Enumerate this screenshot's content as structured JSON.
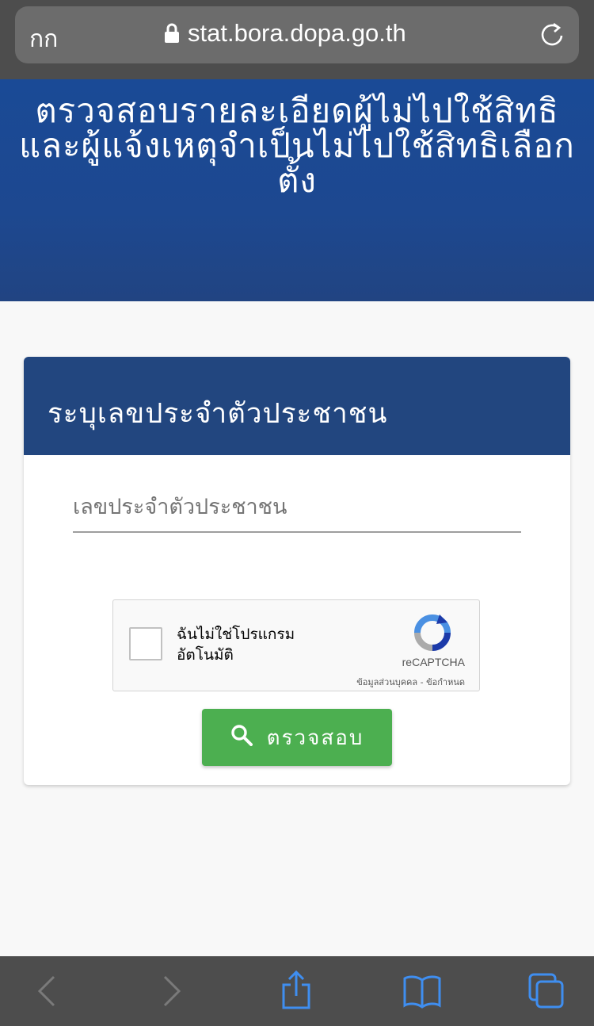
{
  "browser": {
    "text_size_label": "กก",
    "url": "stat.bora.dopa.go.th"
  },
  "header": {
    "title": "ตรวจสอบรายละเอียดผู้ไม่ไปใช้สิทธิและผู้แจ้งเหตุจำเป็นไม่ไปใช้สิทธิเลือกตั้ง"
  },
  "card": {
    "title": "ระบุเลขประจำตัวประชาชน",
    "id_field": {
      "placeholder": "เลขประจำตัวประชาชน",
      "value": ""
    },
    "recaptcha": {
      "label": "ฉันไม่ใช่โปรแกรมอัตโนมัติ",
      "brand": "reCAPTCHA",
      "links": "ข้อมูลส่วนบุคคล - ข้อกำหนด"
    },
    "submit_label": "ตรวจสอบ"
  },
  "toolbar": {
    "icons": [
      "back-icon",
      "forward-icon",
      "share-icon",
      "bookmarks-icon",
      "tabs-icon"
    ]
  },
  "colors": {
    "header_blue": "#1d4890",
    "card_header_blue": "#22467f",
    "button_green": "#4caf50",
    "toolbar_icon_blue": "#3f8ef0"
  }
}
